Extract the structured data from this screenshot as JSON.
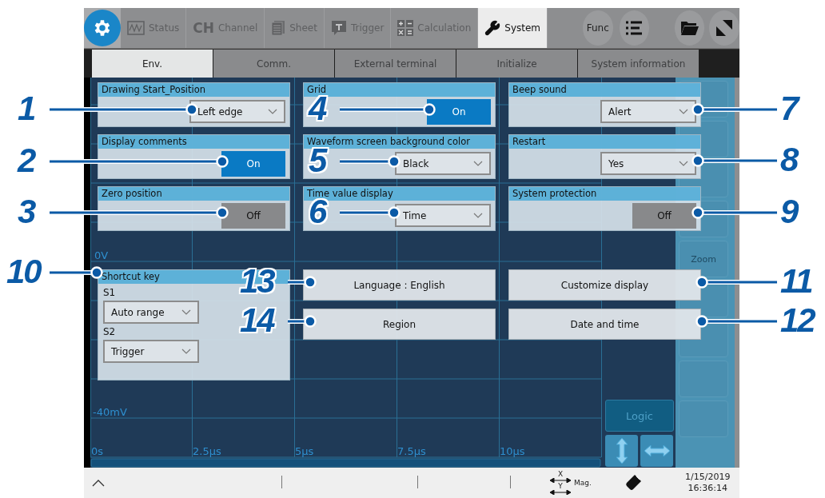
{
  "top_tabs": [
    {
      "label": "Status",
      "selected": false
    },
    {
      "label": "Channel",
      "badge": "CH",
      "selected": false
    },
    {
      "label": "Sheet",
      "selected": false
    },
    {
      "label": "Trigger",
      "selected": false
    },
    {
      "label": "Calculation",
      "selected": false
    },
    {
      "label": "System",
      "selected": true
    }
  ],
  "func_button": "Func",
  "sub_tabs": [
    {
      "label": "Env.",
      "selected": true
    },
    {
      "label": "Comm.",
      "selected": false
    },
    {
      "label": "External terminal",
      "selected": false
    },
    {
      "label": "Initialize",
      "selected": false
    },
    {
      "label": "System information",
      "selected": false
    }
  ],
  "settings": [
    {
      "title": "Drawing Start_Position",
      "kind": "select",
      "value": "Left edge"
    },
    {
      "title": "Grid",
      "kind": "toggle",
      "value": "On",
      "on": true
    },
    {
      "title": "Beep sound",
      "kind": "select",
      "value": "Alert"
    },
    {
      "title": "Display comments",
      "kind": "toggle",
      "value": "On",
      "on": true
    },
    {
      "title": "Waveform screen background color",
      "kind": "select",
      "value": "Black"
    },
    {
      "title": "Restart",
      "kind": "select",
      "value": "Yes"
    },
    {
      "title": "Zero position",
      "kind": "toggle",
      "value": "Off",
      "on": false
    },
    {
      "title": "Time value display",
      "kind": "select",
      "value": "Time"
    },
    {
      "title": "System protection",
      "kind": "toggle",
      "value": "Off",
      "on": false
    }
  ],
  "shortcut_key": {
    "title": "Shortcut key",
    "keys": [
      {
        "label": "S1",
        "value": "Auto range"
      },
      {
        "label": "S2",
        "value": "Trigger"
      }
    ]
  },
  "buttons": [
    [
      "Language : English",
      "Customize display"
    ],
    [
      "Region",
      "Date and time"
    ]
  ],
  "graph": {
    "y_labels": [
      "0V",
      "-40mV"
    ],
    "x_labels": [
      "0s",
      "2.5µs",
      "5µs",
      "7.5µs",
      "10µs"
    ]
  },
  "side_panel": {
    "zoom": "Zoom",
    "logic": "Logic"
  },
  "status_bar": {
    "mag_x": "X",
    "mag_y": "Y",
    "mag_label": "Mag.",
    "date": "1/15/2019",
    "time": "16:36:14"
  },
  "callouts": [
    "1",
    "2",
    "3",
    "4",
    "5",
    "6",
    "7",
    "8",
    "9",
    "10",
    "11",
    "12",
    "13",
    "14"
  ]
}
